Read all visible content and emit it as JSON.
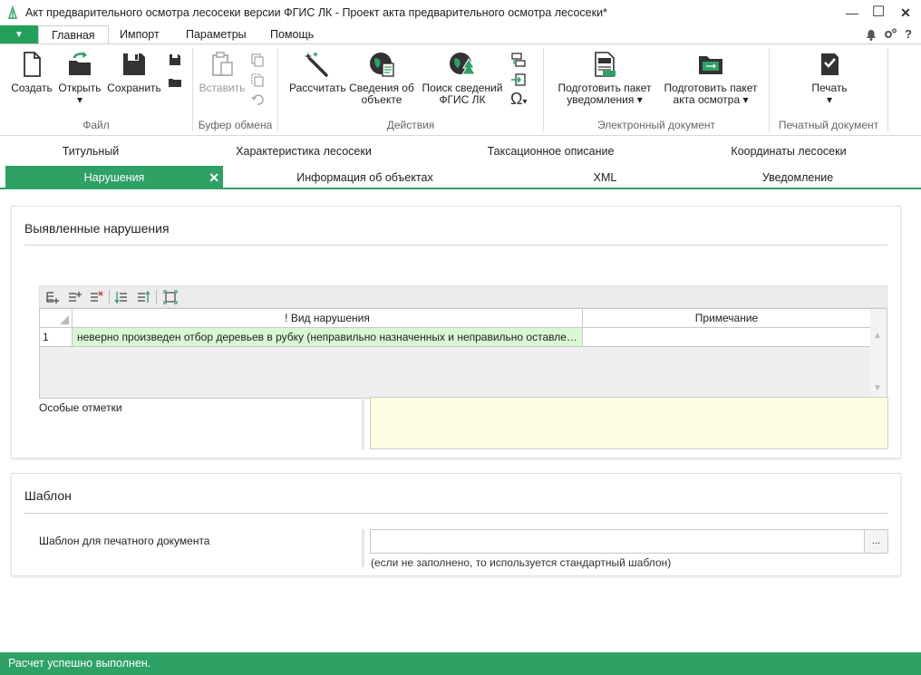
{
  "window": {
    "title": "Акт предварительного осмотра лесосеки версии ФГИС ЛК - Проект акта предварительного осмотра лесосеки*",
    "minimize_glyph": "—",
    "maximize_glyph": "☐",
    "close_glyph": "✕"
  },
  "ribbon_tabs": {
    "file_glyph": "▼",
    "tabs": [
      "Главная",
      "Импорт",
      "Параметры",
      "Помощь"
    ],
    "help_glyph": "?"
  },
  "ribbon": {
    "groups": {
      "file": "Файл",
      "clipboard": "Буфер обмена",
      "actions": "Действия",
      "edoc": "Электронный документ",
      "print": "Печатный документ"
    },
    "buttons": {
      "create": "Создать",
      "open": "Открыть",
      "open_arrow": "▾",
      "save": "Сохранить",
      "paste": "Вставить",
      "calculate": "Рассчитать",
      "object_info_1": "Сведения об",
      "object_info_2": "объекте",
      "search_fgis_1": "Поиск сведений",
      "search_fgis_2": "ФГИС ЛК",
      "omega": "Ω",
      "omega_arrow": "▾",
      "notify_pkg_1": "Подготовить пакет",
      "notify_pkg_2": "уведомления ▾",
      "inspect_pkg_1": "Подготовить пакет",
      "inspect_pkg_2": "акта осмотра ▾",
      "print": "Печать",
      "print_arrow": "▾"
    }
  },
  "doc_tabs": {
    "row1": [
      "Титульный",
      "Характеристика лесосеки",
      "Таксационное описание",
      "Координаты лесосеки"
    ],
    "row2": [
      "Нарушения",
      "Информация об объектах",
      "XML",
      "Уведомление"
    ],
    "close_glyph": "✕"
  },
  "violations": {
    "title": "Выявленные нарушения",
    "columns": [
      "! Вид нарушения",
      "Примечание"
    ],
    "rows": [
      {
        "num": "1",
        "type": "неверно произведен отбор деревьев в рубку (неправильно назначенных и неправильно оставленных деревьев)",
        "note": ""
      }
    ],
    "scroll_up": "▲",
    "scroll_down": "▼",
    "special_notes_label": "Особые отметки",
    "special_notes_value": ""
  },
  "template": {
    "title": "Шаблон",
    "label": "Шаблон для печатного документа",
    "value": "",
    "browse": "...",
    "hint": "(если не заполнено, то используется стандартный шаблон)"
  },
  "status": {
    "text": "Расчет успешно выполнен."
  },
  "colors": {
    "accent": "#2ea165",
    "notes_bg": "#fdfde0",
    "row_bg": "#d9f7d4"
  }
}
